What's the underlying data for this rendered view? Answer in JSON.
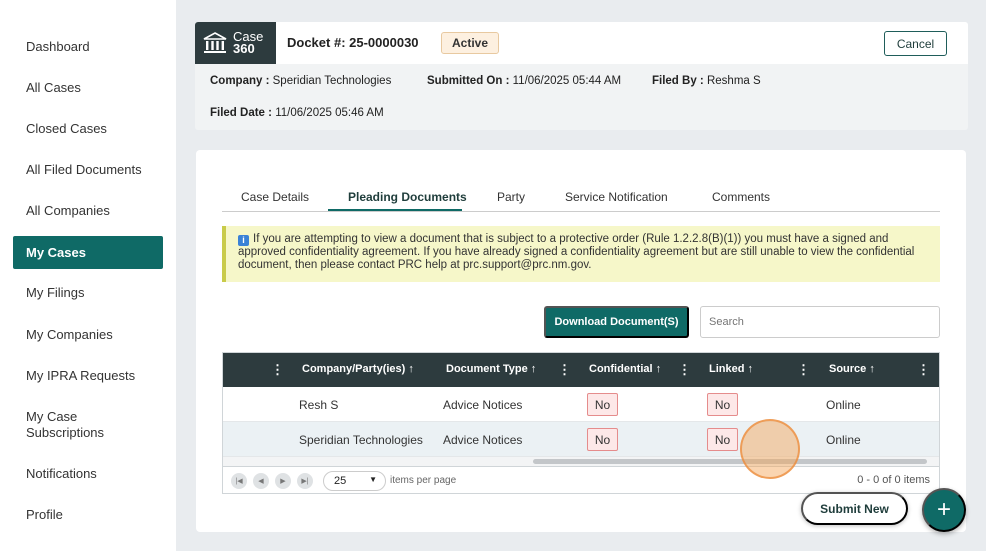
{
  "sidebar": {
    "items": [
      {
        "label": "Dashboard"
      },
      {
        "label": "All Cases"
      },
      {
        "label": "Closed Cases"
      },
      {
        "label": "All Filed Documents"
      },
      {
        "label": "All Companies"
      },
      {
        "label": "My Cases",
        "active": true
      },
      {
        "label": "My Filings"
      },
      {
        "label": "My Companies"
      },
      {
        "label": "My IPRA Requests"
      },
      {
        "label": "My Case Subscriptions"
      },
      {
        "label": "Notifications"
      },
      {
        "label": "Profile"
      }
    ]
  },
  "header": {
    "logo_line1": "Case",
    "logo_line2": "360",
    "docket": "Docket #: 25-0000030",
    "status": "Active",
    "cancel_label": "Cancel",
    "company_label": "Company :",
    "company_value": "Speridian Technologies",
    "submitted_label": "Submitted On :",
    "submitted_value": "11/06/2025 05:44 AM",
    "filed_by_label": "Filed By :",
    "filed_by_value": "Reshma S",
    "filed_date_label": "Filed Date :",
    "filed_date_value": "11/06/2025 05:46 AM"
  },
  "tabs": [
    {
      "label": "Case Details"
    },
    {
      "label": "Pleading Documents",
      "active": true
    },
    {
      "label": "Party"
    },
    {
      "label": "Service Notification"
    },
    {
      "label": "Comments"
    }
  ],
  "notice": {
    "icon": "info-icon",
    "text": "If you are attempting to view a document that is subject to a protective order (Rule 1.2.2.8(B)(1)) you must have a signed and approved confidentiality agreement. If you have already signed a confidentiality agreement but are still unable to view the confidential document, then please contact PRC help at prc.support@prc.nm.gov."
  },
  "toolbar": {
    "download_label": "Download Document(S)",
    "search_placeholder": "Search"
  },
  "grid": {
    "columns": [
      {
        "label": "Company/Party(ies)"
      },
      {
        "label": "Document Type"
      },
      {
        "label": "Confidential"
      },
      {
        "label": "Linked"
      },
      {
        "label": "Source"
      }
    ],
    "sort_glyph": "↑",
    "menu_glyph": "⋮",
    "rows": [
      {
        "company": "Resh S",
        "doc_type": "Advice Notices",
        "confidential": "No",
        "linked": "No",
        "source": "Online"
      },
      {
        "company": "Speridian Technologies",
        "doc_type": "Advice Notices",
        "confidential": "No",
        "linked": "No",
        "source": "Online"
      }
    ],
    "pager": {
      "page_size": "25",
      "per_page_label": "items per page",
      "count_text": "0 - 0 of 0 items"
    }
  },
  "actions": {
    "submit_new_label": "Submit New",
    "fab_label": "+"
  },
  "colors": {
    "accent": "#0f6a66",
    "header_dark": "#2d3b3e",
    "notice_bg": "#f6f7c9"
  }
}
